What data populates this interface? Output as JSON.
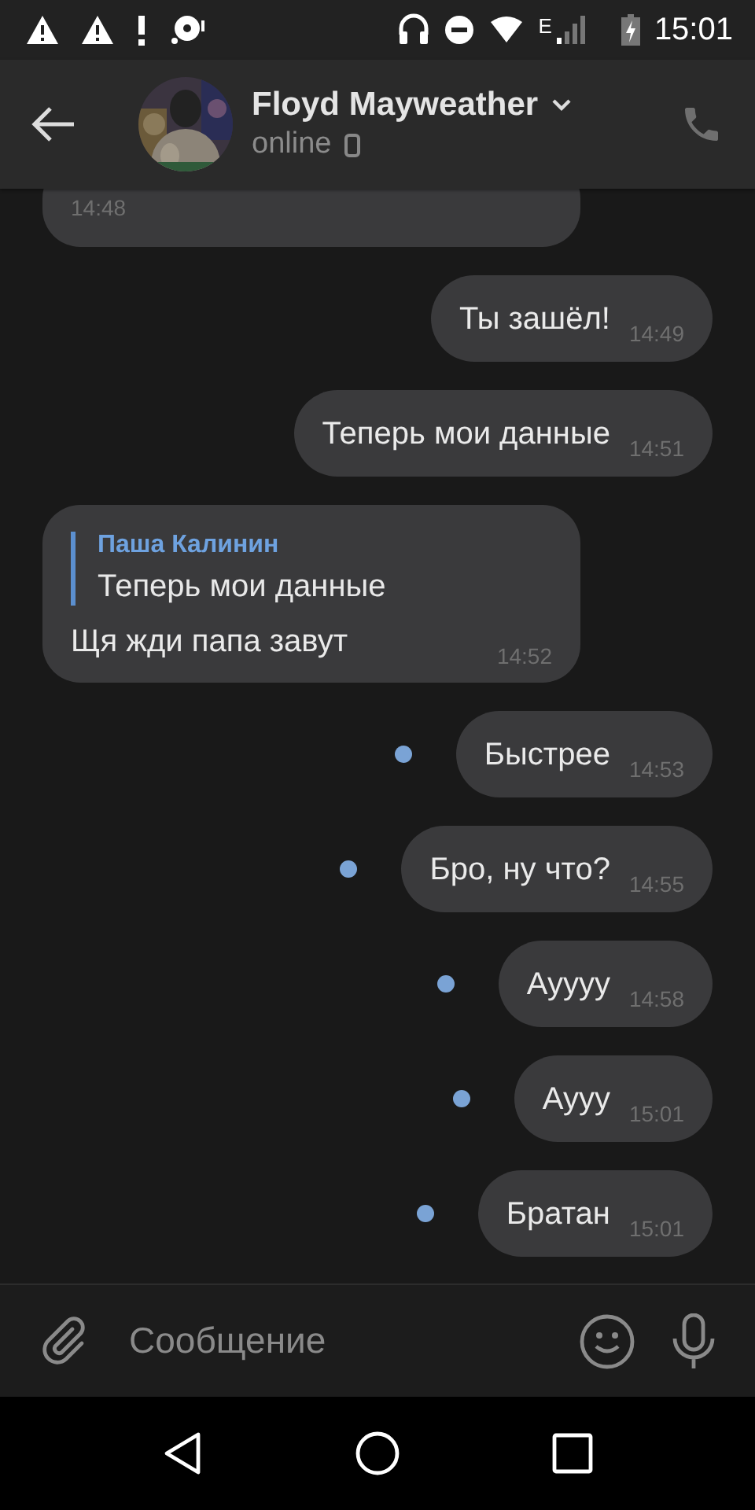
{
  "status_bar": {
    "time": "15:01",
    "network": "E"
  },
  "header": {
    "name": "Floyd Mayweather",
    "status": "online"
  },
  "messages": [
    {
      "kind": "incoming",
      "time": "14:48",
      "unread": false
    },
    {
      "kind": "outgoing",
      "text": "Ты зашёл!",
      "time": "14:49",
      "unread": false
    },
    {
      "kind": "outgoing",
      "text": "Теперь мои данные",
      "time": "14:51",
      "unread": false
    },
    {
      "kind": "incoming",
      "reply": {
        "author": "Паша Калинин",
        "text": "Теперь мои данные"
      },
      "text": "Щя жди папа завут",
      "time": "14:52",
      "unread": false
    },
    {
      "kind": "outgoing",
      "text": "Быстрее",
      "time": "14:53",
      "unread": true
    },
    {
      "kind": "outgoing",
      "text": "Бро, ну что?",
      "time": "14:55",
      "unread": true
    },
    {
      "kind": "outgoing",
      "text": "Ауууу",
      "time": "14:58",
      "unread": true
    },
    {
      "kind": "outgoing",
      "text": "Аууу",
      "time": "15:01",
      "unread": true
    },
    {
      "kind": "outgoing",
      "text": "Братан",
      "time": "15:01",
      "unread": true
    }
  ],
  "composer": {
    "placeholder": "Сообщение"
  }
}
